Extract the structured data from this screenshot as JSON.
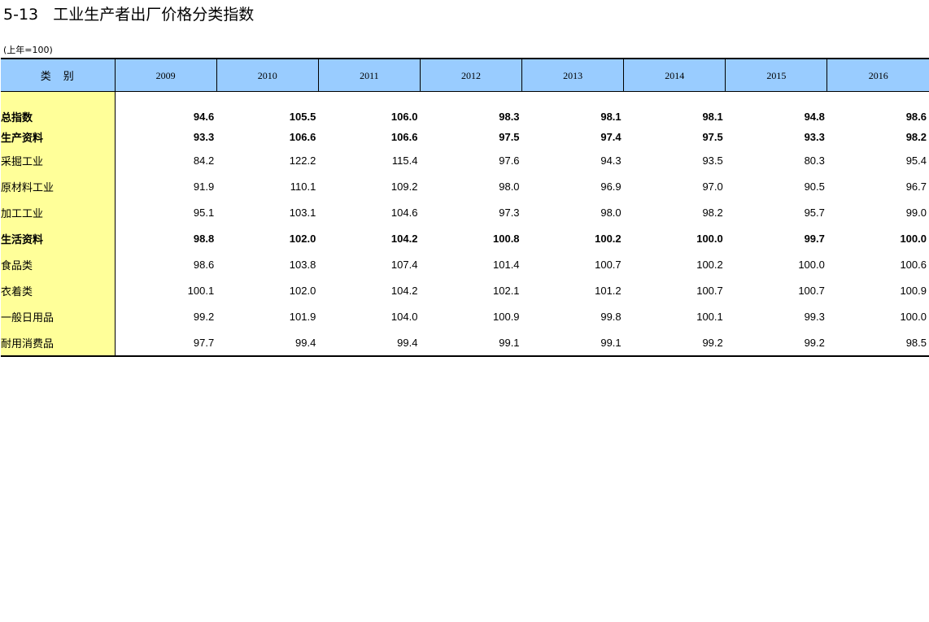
{
  "title": "5-13   工业生产者出厂价格分类指数",
  "unit_note": "(上年=100)",
  "table": {
    "category_header": "类　别",
    "years": [
      "2009",
      "2010",
      "2011",
      "2012",
      "2013",
      "2014",
      "2015",
      "2016"
    ],
    "rows": [
      {
        "label": "总指数",
        "level": 0,
        "bold": true,
        "values": [
          "94.6",
          "105.5",
          "106.0",
          "98.3",
          "98.1",
          "98.1",
          "94.8",
          "98.6"
        ]
      },
      {
        "label": "生产资料",
        "level": 1,
        "bold": true,
        "values": [
          "93.3",
          "106.6",
          "106.6",
          "97.5",
          "97.4",
          "97.5",
          "93.3",
          "98.2"
        ]
      },
      {
        "label": "采掘工业",
        "level": 2,
        "bold": false,
        "values": [
          "84.2",
          "122.2",
          "115.4",
          "97.6",
          "94.3",
          "93.5",
          "80.3",
          "95.4"
        ]
      },
      {
        "label": "原材料工业",
        "level": 2,
        "bold": false,
        "values": [
          "91.9",
          "110.1",
          "109.2",
          "98.0",
          "96.9",
          "97.0",
          "90.5",
          "96.7"
        ]
      },
      {
        "label": "加工工业",
        "level": 2,
        "bold": false,
        "values": [
          "95.1",
          "103.1",
          "104.6",
          "97.3",
          "98.0",
          "98.2",
          "95.7",
          "99.0"
        ]
      },
      {
        "label": "生活资料",
        "level": 1,
        "bold": true,
        "values": [
          "98.8",
          "102.0",
          "104.2",
          "100.8",
          "100.2",
          "100.0",
          "99.7",
          "100.0"
        ]
      },
      {
        "label": "食品类",
        "level": 2,
        "bold": false,
        "values": [
          "98.6",
          "103.8",
          "107.4",
          "101.4",
          "100.7",
          "100.2",
          "100.0",
          "100.6"
        ]
      },
      {
        "label": "衣着类",
        "level": 2,
        "bold": false,
        "values": [
          "100.1",
          "102.0",
          "104.2",
          "102.1",
          "101.2",
          "100.7",
          "100.7",
          "100.9"
        ]
      },
      {
        "label": "一般日用品",
        "level": 2,
        "bold": false,
        "values": [
          "99.2",
          "101.9",
          "104.0",
          "100.9",
          "99.8",
          "100.1",
          "99.3",
          "100.0"
        ]
      },
      {
        "label": "耐用消费品",
        "level": 2,
        "bold": false,
        "values": [
          "97.7",
          "99.4",
          "99.4",
          "99.1",
          "99.1",
          "99.2",
          "99.2",
          "98.5"
        ]
      }
    ]
  }
}
